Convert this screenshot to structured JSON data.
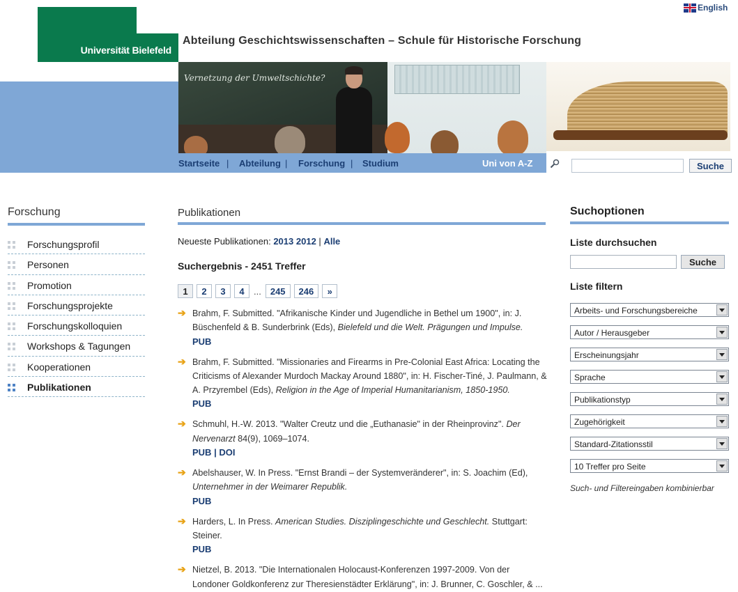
{
  "header": {
    "language_link": "English",
    "logo_text": "Universität Bielefeld",
    "department_title": "Abteilung Geschichtswissenschaften – Schule für Historische Forschung",
    "board_text": "Vernetzung der Umweltschichte?",
    "nav": [
      "Startseite",
      "Abteilung",
      "Forschung",
      "Studium"
    ],
    "nav_az": "Uni von A-Z",
    "search_button": "Suche",
    "search_value": ""
  },
  "sidebar": {
    "heading": "Forschung",
    "items": [
      {
        "label": "Forschungsprofil"
      },
      {
        "label": "Personen"
      },
      {
        "label": "Promotion"
      },
      {
        "label": "Forschungsprojekte"
      },
      {
        "label": "Forschungskolloquien"
      },
      {
        "label": "Workshops & Tagungen"
      },
      {
        "label": "Kooperationen"
      },
      {
        "label": "Publikationen",
        "active": true
      }
    ]
  },
  "main": {
    "heading": "Publikationen",
    "latest_label": "Neueste Publikationen:",
    "latest_links": [
      "2013",
      "2012",
      "Alle"
    ],
    "result_count": "Suchergebnis - 2451 Treffer",
    "pagination": [
      "1",
      "2",
      "3",
      "4",
      "245",
      "246",
      "»"
    ],
    "pagination_ellipsis": "...",
    "results": [
      {
        "pre": "Brahm, F. Submitted. \"Afrikanische Kinder und Jugendliche in Bethel um 1900\", in: J. Büschenfeld & B. Sunderbrink (Eds), ",
        "italic": "Bielefeld und die Welt. Prägungen und Impulse.",
        "post": "",
        "links": [
          "PUB"
        ]
      },
      {
        "pre": "Brahm, F. Submitted. \"Missionaries and Firearms in Pre-Colonial East Africa: Locating the Criticisms of Alexander Murdoch Mackay Around 1880\", in: H. Fischer-Tiné, J. Paulmann, & A. Przyrembel (Eds), ",
        "italic": "Religion in the Age of Imperial Humanitarianism, 1850-1950.",
        "post": "",
        "links": [
          "PUB"
        ]
      },
      {
        "pre": "Schmuhl, H.-W. 2013. \"Walter Creutz und die „Euthanasie\" in der Rheinprovinz\". ",
        "italic": "Der Nervenarzt",
        "post": " 84(9), 1069–1074.",
        "links": [
          "PUB",
          "DOI"
        ]
      },
      {
        "pre": "Abelshauser, W. In Press. \"Ernst Brandi – der Systemveränderer\", in: S. Joachim (Ed), ",
        "italic": "Unternehmer in der Weimarer Republik.",
        "post": "",
        "links": [
          "PUB"
        ]
      },
      {
        "pre": "Harders, L. In Press. ",
        "italic": "American Studies. Disziplingeschichte und Geschlecht.",
        "post": " Stuttgart: Steiner.",
        "links": [
          "PUB"
        ]
      },
      {
        "pre": "Nietzel, B. 2013. \"Die Internationalen Holocaust-Konferenzen 1997-2009. Von der Londoner Goldkonferenz zur Theresienstädter Erklärung\", in: J. Brunner, C. Goschler, & ...",
        "italic": "",
        "post": "",
        "links": []
      }
    ]
  },
  "right": {
    "heading": "Suchoptionen",
    "list_search_label": "Liste durchsuchen",
    "list_search_button": "Suche",
    "list_search_value": "",
    "list_filter_label": "Liste filtern",
    "filters": [
      "Arbeits- und Forschungsbereiche",
      "Autor / Herausgeber",
      "Erscheinungsjahr",
      "Sprache",
      "Publikationstyp",
      "Zugehörigkeit",
      "Standard-Zitationsstil",
      "10 Treffer pro Seite"
    ],
    "note": "Such- und Filtereingaben kombinierbar"
  },
  "colors": {
    "brand_green": "#0a7a4d",
    "accent_blue": "#7fa7d6",
    "link_blue": "#1b3e73",
    "arrow_orange": "#e8a317"
  },
  "icons": {
    "flag": "uk-flag-icon",
    "search": "magnifier-icon",
    "bullet": "arrow-right-icon",
    "menu_bullet": "dot-grid-icon",
    "dropdown": "chevron-down-icon"
  }
}
